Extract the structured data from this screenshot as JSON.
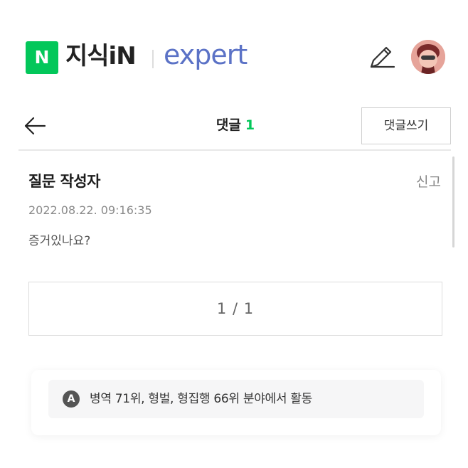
{
  "header": {
    "logo_n": "N",
    "logo_kin": "지식iN",
    "logo_expert": "expert"
  },
  "navbar": {
    "title": "댓글",
    "count": "1",
    "write_button": "댓글쓰기"
  },
  "comment": {
    "author": "질문 작성자",
    "report": "신고",
    "date": "2022.08.22. 09:16:35",
    "text": "증거있나요?"
  },
  "pagination": {
    "label": "1 / 1"
  },
  "expert_info": {
    "icon_letter": "A",
    "text": "병역 71위, 형벌, 형집행 66위 분야에서 활동"
  },
  "colors": {
    "naver_green": "#03c75a",
    "expert_blue": "#5b72c6"
  }
}
